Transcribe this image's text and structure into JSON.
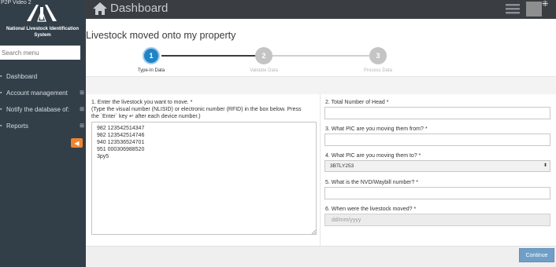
{
  "window": {
    "video_tag": "P2P Video 2"
  },
  "sidebar": {
    "org_name": "National Livestock Identification System",
    "search_placeholder": "Search menu",
    "items": [
      {
        "icon": "dashboard-icon",
        "label": "Dashboard",
        "has_expand": false
      },
      {
        "icon": "user-icon",
        "label": "Account management",
        "has_expand": true
      },
      {
        "icon": "bell-icon",
        "label": "Notify the database of:",
        "has_expand": true
      },
      {
        "icon": "reports-icon",
        "label": "Reports",
        "has_expand": true
      }
    ],
    "collapse_icon": "arrow-left-circle-icon",
    "accent_color": "#f0842e"
  },
  "topbar": {
    "title": "Dashboard"
  },
  "form": {
    "title": "Livestock moved onto my property",
    "steps": [
      {
        "number": "1",
        "label": "Type-In Data",
        "active": true
      },
      {
        "number": "2",
        "label": "Validate Data",
        "active": false
      },
      {
        "number": "3",
        "label": "Process Data",
        "active": false
      }
    ],
    "step_active_color": "#1f84c6",
    "step_inactive_color": "#c4c4c4"
  },
  "left": {
    "q1_line1": "1. Enter the livestock you want to move. *",
    "q1_line2": "(Type the visual number (NLISID) or electronic number (RFID) in the box below. Press",
    "q1_line3": "the `Enter` key ↵ after each device number.)",
    "device_lines": [
      "982 123542514347",
      "982 123542514746",
      "940 123536524701",
      "951 000306988520",
      "3py5"
    ]
  },
  "right": {
    "q2_label": "2. Total Number of Head *",
    "q3_label": "3. What PIC are you moving them from? *",
    "q4_label": "4. What PIC are you moving them to? *",
    "q4_selected": "3BTLY253",
    "q5_label": "5. What is the NVD/Waybill number? *",
    "q6_label": "6. When were the livestock moved? *",
    "q6_placeholder": "dd/mm/yyyy"
  },
  "footer": {
    "continue_label": "Continue"
  }
}
